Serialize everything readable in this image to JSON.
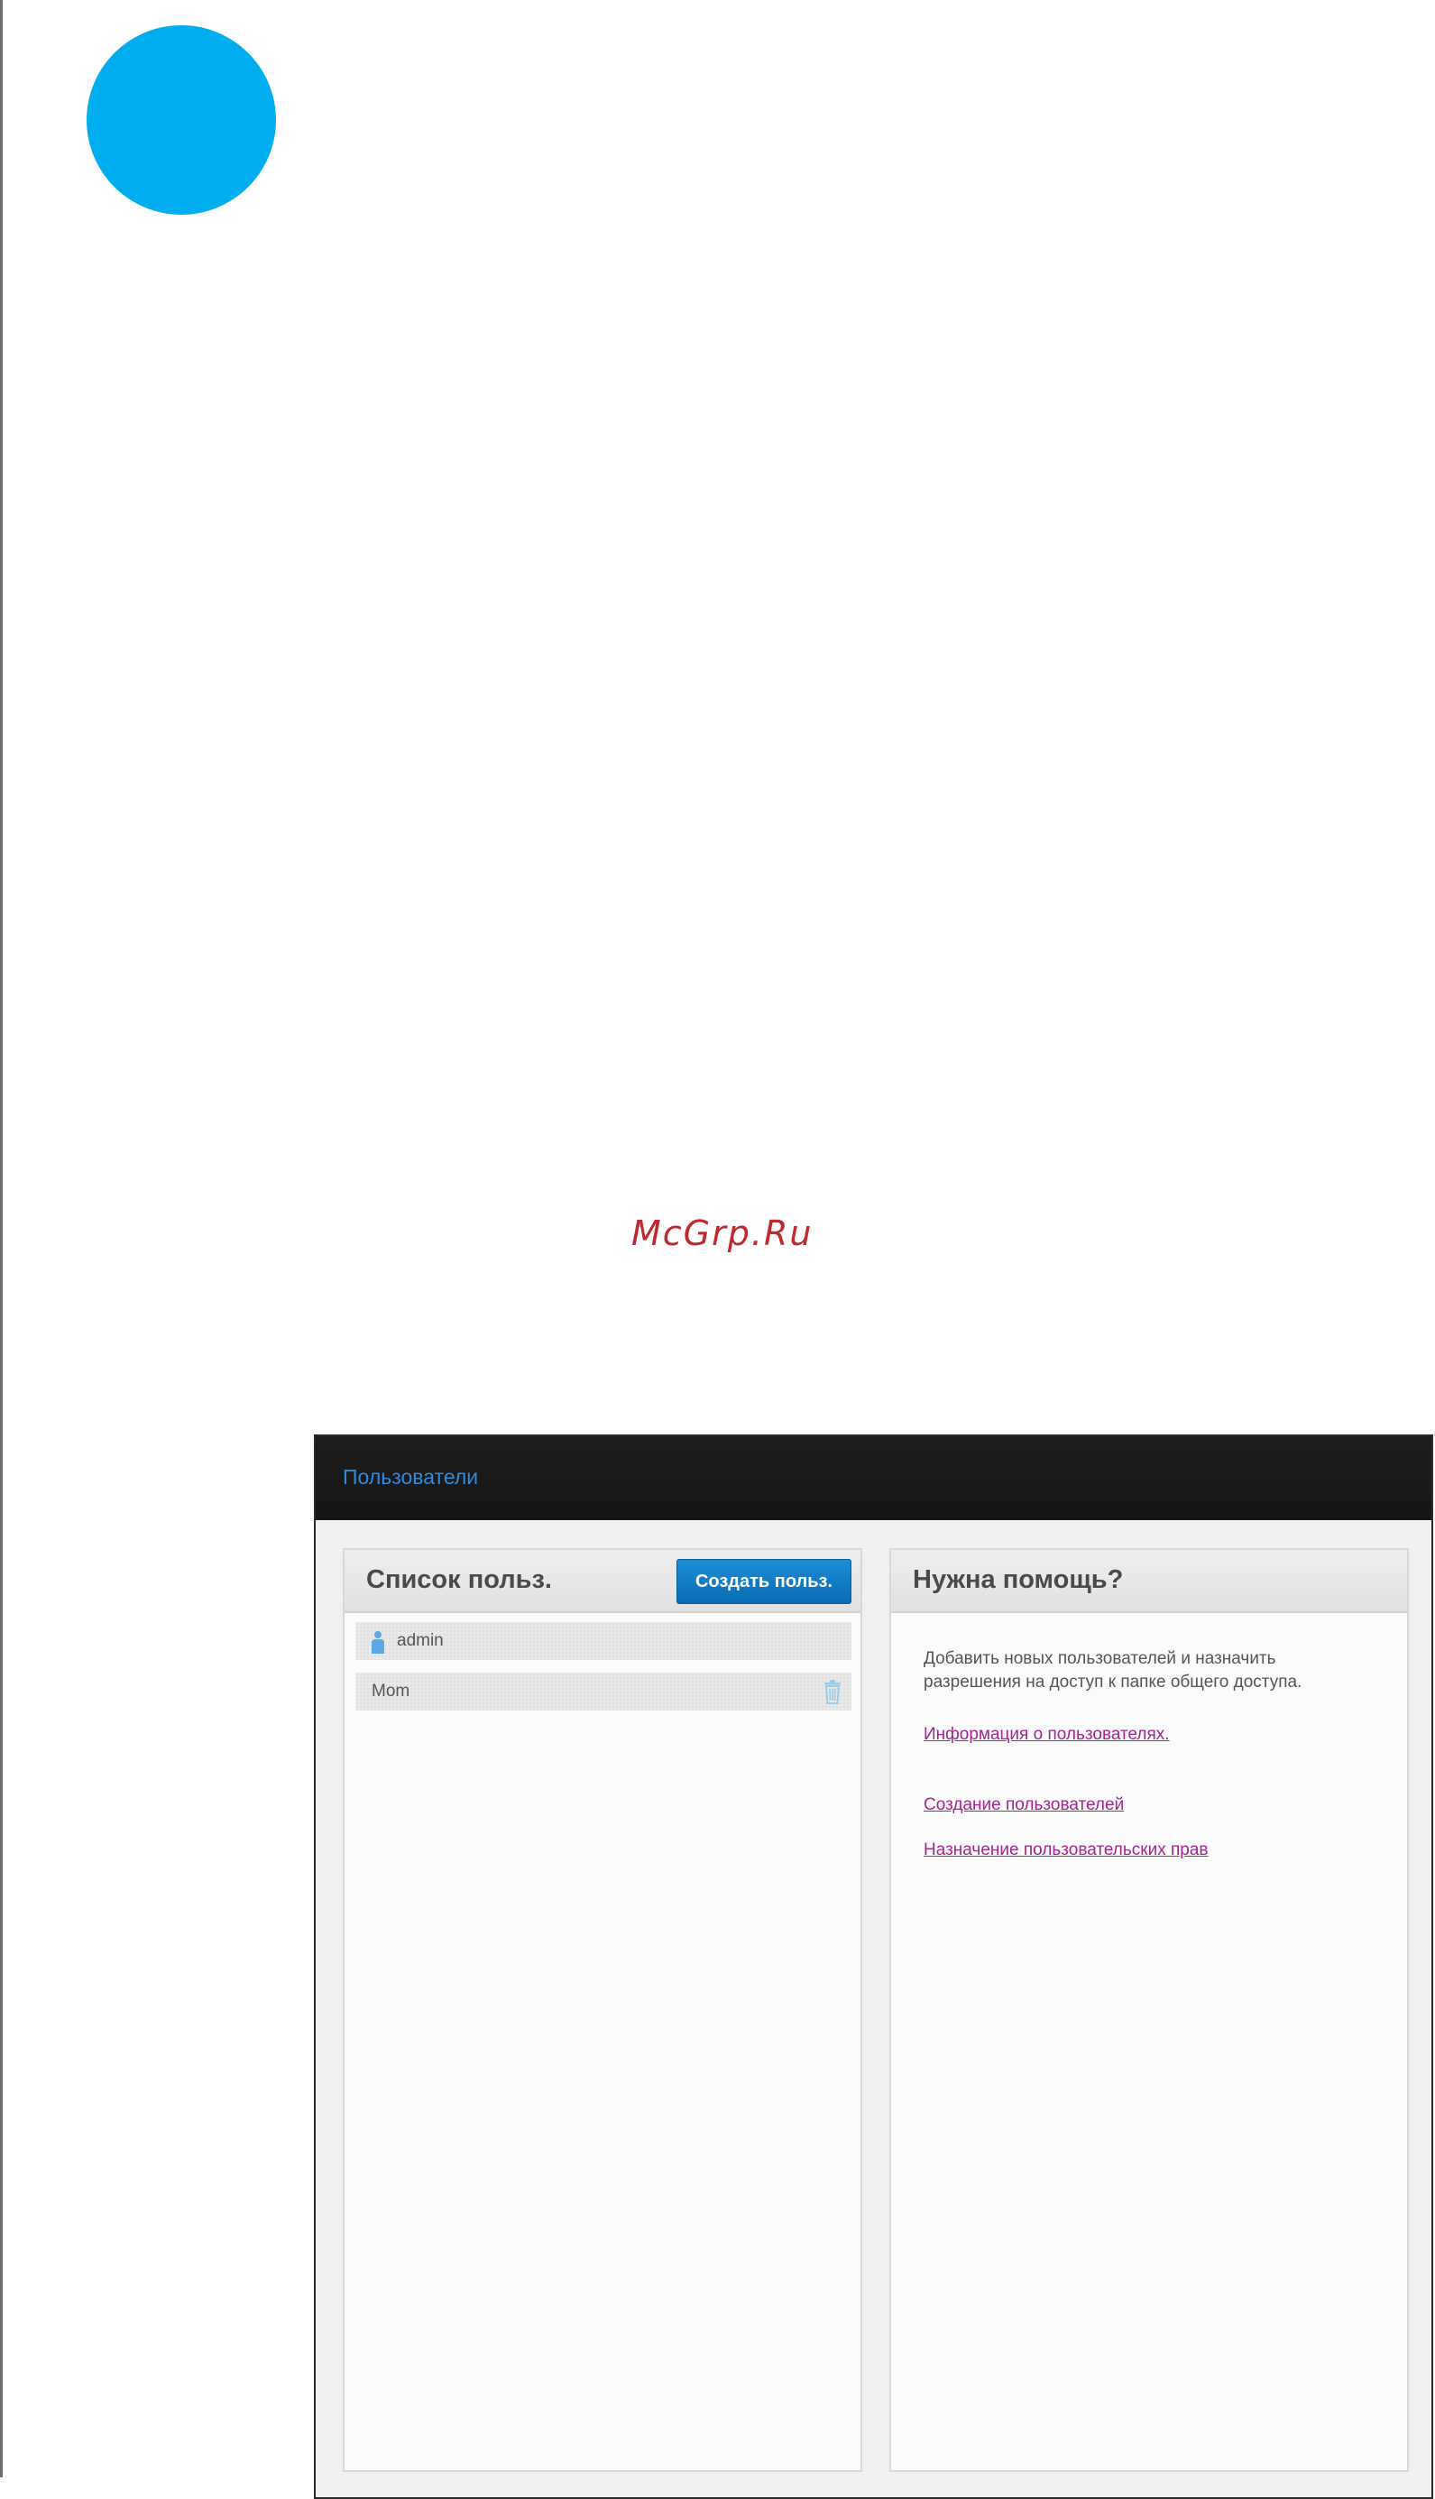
{
  "page": {
    "watermark": "McGrp.Ru",
    "accent_color": "#00adef"
  },
  "app": {
    "title": "Пользователи",
    "title_color": "#2d8be0"
  },
  "user_list": {
    "title": "Список польз.",
    "create_button_label": "Создать польз.",
    "users": [
      {
        "name": "admin",
        "icon": "user-icon",
        "deletable": false
      },
      {
        "name": "Mom",
        "icon": null,
        "deletable": true
      }
    ]
  },
  "help": {
    "title": "Нужна помощь?",
    "text": "Добавить новых пользователей и назначить разрешения на доступ к папке общего доступа.",
    "links": [
      "Информация о пользователях.",
      "Создание пользователей",
      "Назначение пользовательских прав"
    ],
    "link_color": "#a3258f"
  }
}
